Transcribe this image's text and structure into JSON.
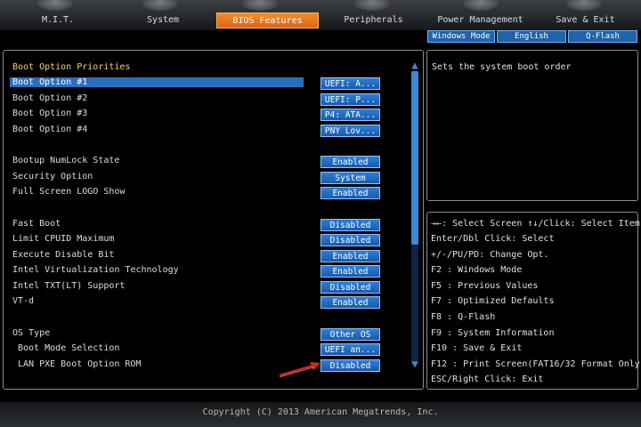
{
  "tabs": [
    {
      "label": "M.I.T."
    },
    {
      "label": "System"
    },
    {
      "label": "BIOS Features"
    },
    {
      "label": "Peripherals"
    },
    {
      "label": "Power Management"
    },
    {
      "label": "Save & Exit"
    }
  ],
  "subtabs": [
    {
      "label": "Windows Mode"
    },
    {
      "label": "English"
    },
    {
      "label": "Q-Flash"
    }
  ],
  "section_header": "Boot Option Priorities",
  "settings": [
    {
      "label": "Boot Option #1",
      "value": "UEFI: A..."
    },
    {
      "label": "Boot Option #2",
      "value": "UEFI: P..."
    },
    {
      "label": "Boot Option #3",
      "value": "P4: ATA..."
    },
    {
      "label": "Boot Option #4",
      "value": "PNY Lov..."
    },
    {
      "label": "Bootup NumLock State",
      "value": "Enabled"
    },
    {
      "label": "Security Option",
      "value": "System"
    },
    {
      "label": "Full Screen LOGO Show",
      "value": "Enabled"
    },
    {
      "label": "Fast Boot",
      "value": "Disabled"
    },
    {
      "label": "Limit CPUID Maximum",
      "value": "Disabled"
    },
    {
      "label": "Execute Disable Bit",
      "value": "Enabled"
    },
    {
      "label": "Intel Virtualization Technology",
      "value": "Enabled"
    },
    {
      "label": "Intel TXT(LT) Support",
      "value": "Disabled"
    },
    {
      "label": "VT-d",
      "value": "Enabled"
    },
    {
      "label": "OS Type",
      "value": "Other OS"
    },
    {
      "label": "Boot Mode Selection",
      "value": "UEFI an..."
    },
    {
      "label": "LAN PXE Boot Option ROM",
      "value": "Disabled"
    }
  ],
  "help_description": "Sets the system boot order",
  "key_help": [
    "→←: Select Screen  ↑↓/Click: Select Item",
    "Enter/Dbl Click: Select",
    "+/-/PU/PD: Change Opt.",
    "F2  : Windows Mode",
    "F5  : Previous Values",
    "F7  : Optimized Defaults",
    "F8  : Q-Flash",
    "F9  : System Information",
    "F10 : Save & Exit",
    "F12 : Print Screen(FAT16/32 Format Only)",
    "ESC/Right Click: Exit"
  ],
  "footer": "Copyright (C) 2013 American Megatrends, Inc.",
  "colors": {
    "active_tab": "#f58d2a",
    "value_button": "#2d7fd8",
    "header_text": "#f2d46a"
  }
}
